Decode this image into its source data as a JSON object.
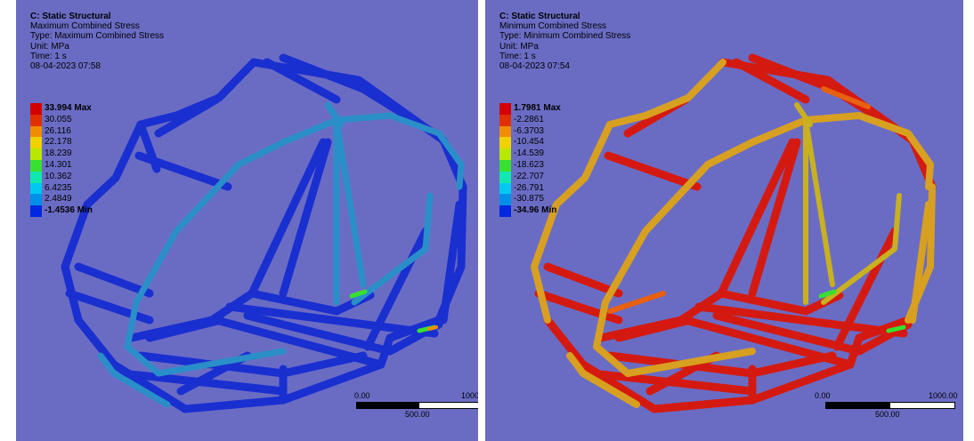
{
  "left_view": {
    "analysis": "C: Static Structural",
    "result": "Maximum Combined Stress",
    "type": "Type: Maximum Combined Stress",
    "unit": "Unit: MPa",
    "time": "Time: 1 s",
    "date": "08-04-2023 07:58",
    "legend": [
      {
        "label": "33.994 Max",
        "color": "#d40000"
      },
      {
        "label": "30.055",
        "color": "#e03000"
      },
      {
        "label": "26.116",
        "color": "#f08c00"
      },
      {
        "label": "22.178",
        "color": "#f0d200"
      },
      {
        "label": "18.239",
        "color": "#b8e800"
      },
      {
        "label": "14.301",
        "color": "#38e030"
      },
      {
        "label": "10.362",
        "color": "#10e8b0"
      },
      {
        "label": "6.4235",
        "color": "#00c8f0"
      },
      {
        "label": "2.4849",
        "color": "#0090e8"
      },
      {
        "label": "-1.4536 Min",
        "color": "#0028e0"
      }
    ],
    "scale": {
      "start": "0.00",
      "mid": "500.00",
      "end": "1000"
    }
  },
  "right_view": {
    "analysis": "C: Static Structural",
    "result": "Minimum Combined Stress",
    "type": "Type: Minimum Combined Stress",
    "unit": "Unit: MPa",
    "time": "Time: 1 s",
    "date": "08-04-2023 07:54",
    "legend": [
      {
        "label": "1.7981 Max",
        "color": "#d40000"
      },
      {
        "label": "-2.2861",
        "color": "#e03000"
      },
      {
        "label": "-6.3703",
        "color": "#f08c00"
      },
      {
        "label": "-10.454",
        "color": "#f0d200"
      },
      {
        "label": "-14.539",
        "color": "#b8e800"
      },
      {
        "label": "-18.623",
        "color": "#38e030"
      },
      {
        "label": "-22.707",
        "color": "#10e8b0"
      },
      {
        "label": "-26.791",
        "color": "#00c8f0"
      },
      {
        "label": "-30.875",
        "color": "#0090e8"
      },
      {
        "label": "-34.96 Min",
        "color": "#0028e0"
      }
    ],
    "scale": {
      "start": "0.00",
      "mid": "500.00",
      "end": "1000.00"
    }
  },
  "colors": {
    "background": "#6a6cc4",
    "left_frame_main": "#1a2fd0",
    "left_frame_accent": "#2a8fc8",
    "right_frame_main": "#d41a10",
    "right_frame_accent": "#d8a020",
    "hotspot": "#30e860"
  }
}
